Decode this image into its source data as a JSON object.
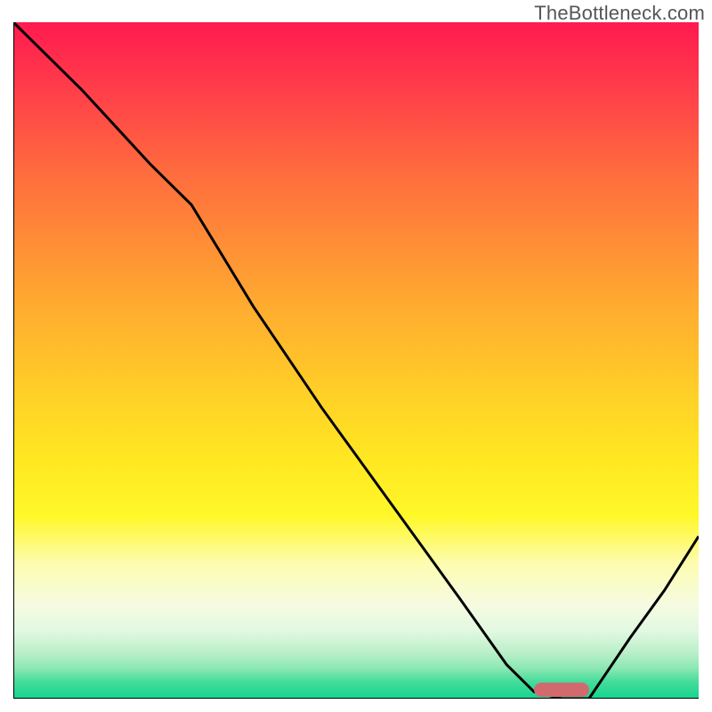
{
  "watermark": "TheBottleneck.com",
  "colors": {
    "curve": "#000000",
    "marker": "#d16a6f",
    "axis": "#000000"
  },
  "chart_data": {
    "type": "line",
    "title": "",
    "xlabel": "",
    "ylabel": "",
    "xlim": [
      0,
      100
    ],
    "ylim": [
      0,
      100
    ],
    "series": [
      {
        "name": "bottleneck-curve",
        "x": [
          0,
          10,
          20,
          26,
          35,
          45,
          55,
          65,
          72,
          76,
          80,
          84,
          90,
          95,
          100
        ],
        "y": [
          100,
          90,
          79,
          73,
          58,
          43,
          29,
          15,
          5,
          1,
          0,
          0,
          9,
          16,
          24
        ]
      }
    ],
    "annotations": [
      {
        "name": "optimal-range-marker",
        "x_start": 76,
        "x_end": 84,
        "y": 0
      }
    ]
  }
}
